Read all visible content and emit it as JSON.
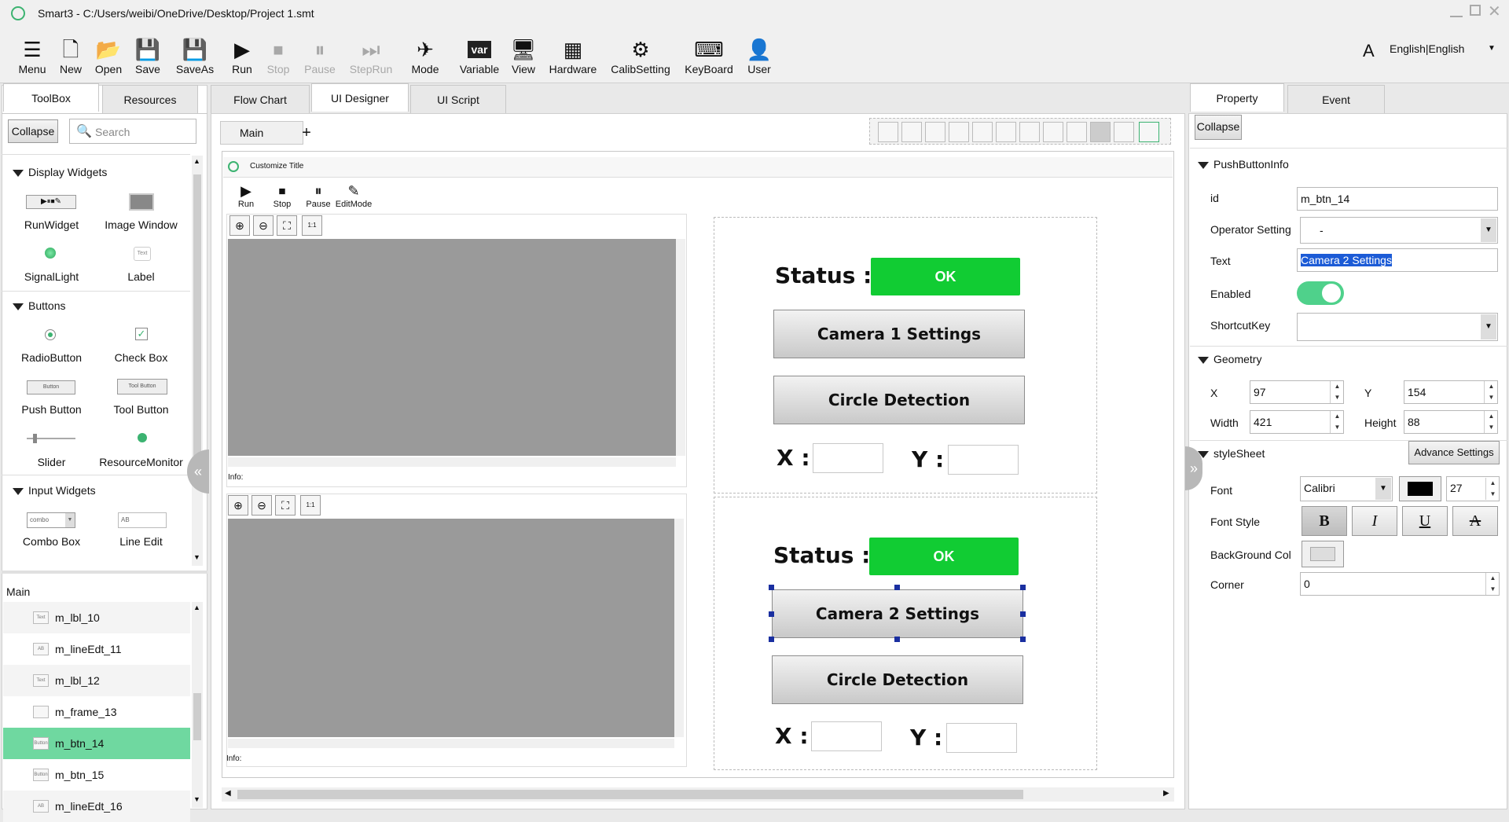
{
  "window": {
    "title": "Smart3 - C:/Users/weibi/OneDrive/Desktop/Project 1.smt"
  },
  "toolbar": {
    "menu": "Menu",
    "new": "New",
    "open": "Open",
    "save": "Save",
    "saveas": "SaveAs",
    "run": "Run",
    "stop": "Stop",
    "pause": "Pause",
    "steprun": "StepRun",
    "mode": "Mode",
    "variable": "Variable",
    "view": "View",
    "hardware": "Hardware",
    "calib": "CalibSetting",
    "keyboard": "KeyBoard",
    "user": "User",
    "language": "English|English",
    "variable_icon_text": "var"
  },
  "left_tabs": {
    "toolbox": "ToolBox",
    "resources": "Resources"
  },
  "toolbox": {
    "collapse": "Collapse",
    "search_placeholder": "Search",
    "display_title": "Display Widgets",
    "run_widget": "RunWidget",
    "image_window": "Image Window",
    "signal_light": "SignalLight",
    "label": "Label",
    "label_icon": "Text",
    "buttons_title": "Buttons",
    "radio": "RadioButton",
    "check": "Check Box",
    "push": "Push Button",
    "tool": "Tool Button",
    "push_icon": "Button",
    "tool_icon": "Tool Button",
    "slider": "Slider",
    "resmon": "ResourceMonitor",
    "input_title": "Input Widgets",
    "combo": "Combo Box",
    "lineedit": "Line Edit",
    "combo_icon": "combo",
    "lineedit_icon": "AB"
  },
  "tree": {
    "title": "Main",
    "items": [
      {
        "label": "m_lbl_10",
        "icon": "Text"
      },
      {
        "label": "m_lineEdt_11",
        "icon": "AB"
      },
      {
        "label": "m_lbl_12",
        "icon": "Text"
      },
      {
        "label": "m_frame_13",
        "icon": ""
      },
      {
        "label": "m_btn_14",
        "icon": "Button"
      },
      {
        "label": "m_btn_15",
        "icon": "Button"
      },
      {
        "label": "m_lineEdt_16",
        "icon": "AB"
      }
    ]
  },
  "center_tabs": {
    "flow": "Flow Chart",
    "designer": "UI Designer",
    "script": "UI Script"
  },
  "page_tab": {
    "main": "Main",
    "add": "+"
  },
  "canvas": {
    "title": "Customize Title",
    "run": "Run",
    "stop": "Stop",
    "pause": "Pause",
    "edit": "EditMode",
    "info": "Info:",
    "zoom_fit": "1:1",
    "status_label": "Status :",
    "ok": "OK",
    "cam1": "Camera 1 Settings",
    "cam2": "Camera 2 Settings",
    "circle": "Circle Detection",
    "x": "X :",
    "y": "Y :"
  },
  "right_tabs": {
    "property": "Property",
    "event": "Event"
  },
  "props": {
    "collapse": "Collapse",
    "pbinfo": "PushButtonInfo",
    "id_label": "id",
    "id": "m_btn_14",
    "op_label": "Operator Setting",
    "op": "-",
    "text_label": "Text",
    "text": "Camera 2 Settings",
    "enabled_label": "Enabled",
    "shortcut_label": "ShortcutKey",
    "geometry": "Geometry",
    "x_label": "X",
    "x": "97",
    "y_label": "Y",
    "y": "154",
    "w_label": "Width",
    "w": "421",
    "h_label": "Height",
    "h": "88",
    "stylesheet": "styleSheet",
    "advance": "Advance Settings",
    "font_label": "Font",
    "font": "Calibri",
    "font_size": "27",
    "fontstyle_label": "Font Style",
    "bold": "B",
    "italic": "I",
    "underline": "U",
    "strike": "A",
    "bg_label": "BackGround Col",
    "corner_label": "Corner",
    "corner": "0"
  },
  "colors": {
    "ok_green": "#11cc33",
    "toggle_green": "#4fd18b",
    "selected_row": "#6fd8a0"
  }
}
